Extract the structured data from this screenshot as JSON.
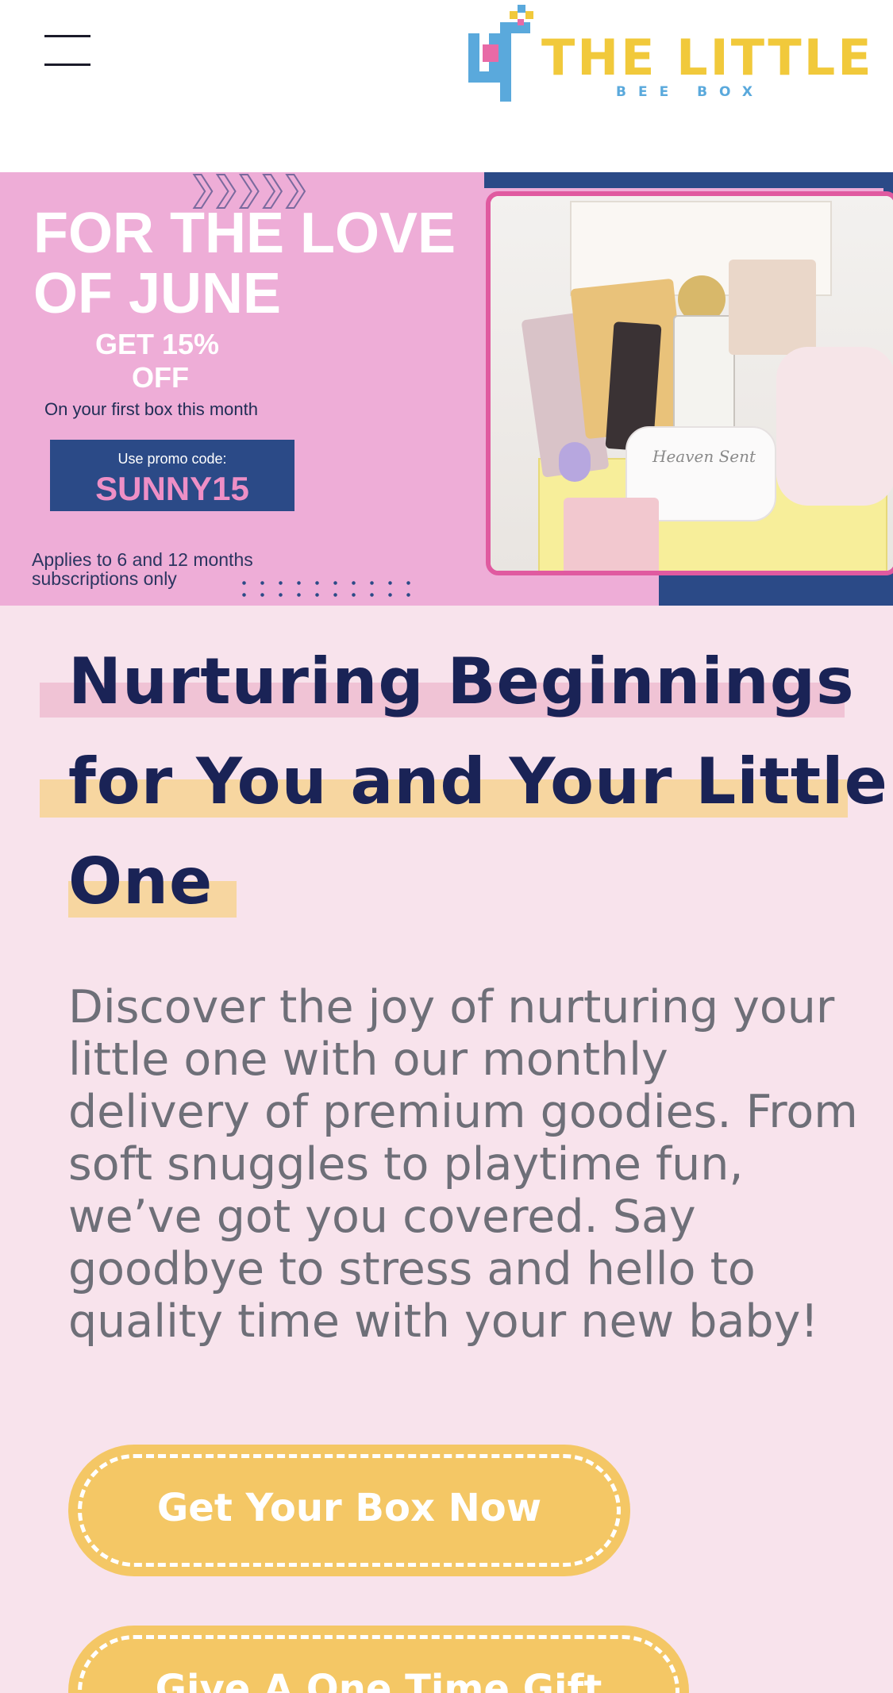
{
  "header": {
    "menu_icon": "hamburger-menu-icon",
    "logo": {
      "title": "THE LITTLE",
      "subtitle": "BEE BOX",
      "mark_icon": "bee-box-logo-mark",
      "colors": {
        "yellow": "#f1c93b",
        "blue": "#5aa9dc",
        "pink": "#e86aa6"
      }
    }
  },
  "banner": {
    "headline_line1": "FOR THE LOVE",
    "headline_line2": "OF JUNE",
    "offer_line1": "GET 15%",
    "offer_line2": "OFF",
    "offer_detail": "On your first box this month",
    "promo_label": "Use promo code:",
    "promo_code": "SUNNY15",
    "fine_print_line1": "Applies to 6 and 12 months",
    "fine_print_line2": "subscriptions only",
    "photo_text": "Heaven Sent",
    "colors": {
      "pink": "#eeadd7",
      "navy": "#2b4a87",
      "frame": "#e05aa0"
    }
  },
  "main": {
    "heading_lines": [
      "Nurturing Beginnings",
      "for You and Your Little",
      "One"
    ],
    "body": "Discover the joy of nurturing your little one with our monthly delivery of premium goodies. From soft snuggles to playtime fun, we’ve got you covered. Say goodbye to stress and hello to quality time with your new baby!",
    "cta_primary": "Get Your Box Now",
    "cta_secondary": "Give A One Time Gift",
    "colors": {
      "background": "#f8e3ec",
      "heading": "#1a2356",
      "body": "#6e6f78",
      "button": "#f4c765",
      "highlight_pink": "#f0c3d5",
      "highlight_yellow": "#f7d6a0"
    }
  }
}
